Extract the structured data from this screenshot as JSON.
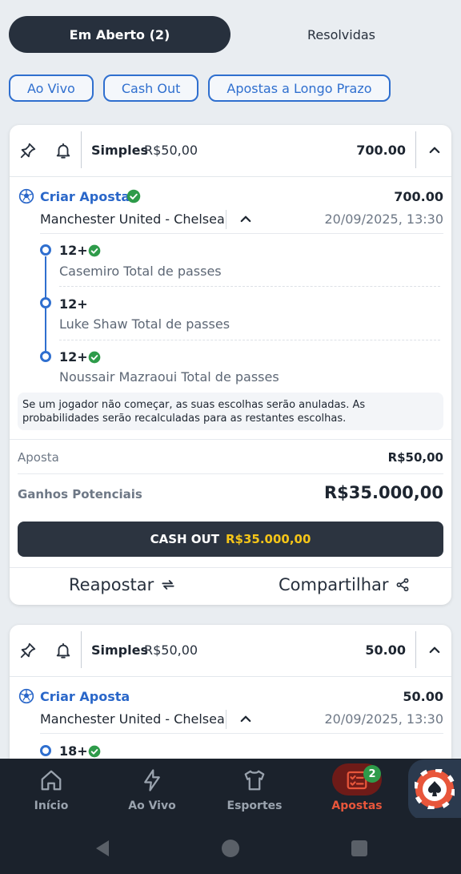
{
  "tabs": {
    "active": "Em Aberto (2)",
    "inactive": "Resolvidas"
  },
  "filters": [
    "Ao Vivo",
    "Cash Out",
    "Apostas a Longo Prazo"
  ],
  "colors": {
    "accent": "#2f6fcf",
    "dark": "#27303d",
    "success": "#2e9b4a",
    "active_nav": "#e8563b",
    "cashout_value": "#f5c518"
  },
  "bets": [
    {
      "type": "Simples",
      "stake_header": "R$50,00",
      "odds_header": "700.00",
      "event": {
        "name": "Criar Aposta",
        "odds": "700.00",
        "match": "Manchester United - Chelsea",
        "datetime": "20/09/2025, 13:30"
      },
      "legs": [
        {
          "value": "12+",
          "description": "Casemiro Total de passes",
          "won": true
        },
        {
          "value": "12+",
          "description": "Luke Shaw Total de passes",
          "won": false
        },
        {
          "value": "12+",
          "description": "Noussair Mazraoui Total de passes",
          "won": true
        }
      ],
      "note": "Se um jogador não começar, as suas escolhas serão anuladas. As probabilidades serão recalculadas para as restantes escolhas.",
      "stake_label": "Aposta",
      "stake_value": "R$50,00",
      "winnings_label": "Ganhos Potenciais",
      "winnings_value": "R$35.000,00",
      "cashout_label": "CASH OUT",
      "cashout_value": "R$35.000,00",
      "rebet_label": "Reapostar",
      "share_label": "Compartilhar"
    },
    {
      "type": "Simples",
      "stake_header": "R$50,00",
      "odds_header": "50.00",
      "event": {
        "name": "Criar Aposta",
        "odds": "50.00",
        "match": "Manchester United - Chelsea",
        "datetime": "20/09/2025, 13:30"
      },
      "legs": [
        {
          "value": "18+",
          "won": true
        }
      ]
    }
  ],
  "bottom_nav": {
    "items": [
      {
        "label": "Início",
        "icon": "home-icon"
      },
      {
        "label": "Ao Vivo",
        "icon": "lightning-icon"
      },
      {
        "label": "Esportes",
        "icon": "jersey-icon"
      },
      {
        "label": "Apostas",
        "icon": "betslip-icon",
        "active": true,
        "badge": "2"
      }
    ],
    "casino_icon": "poker-chip-icon"
  },
  "system_nav": [
    "back-icon",
    "home-circle-icon",
    "recents-icon"
  ]
}
